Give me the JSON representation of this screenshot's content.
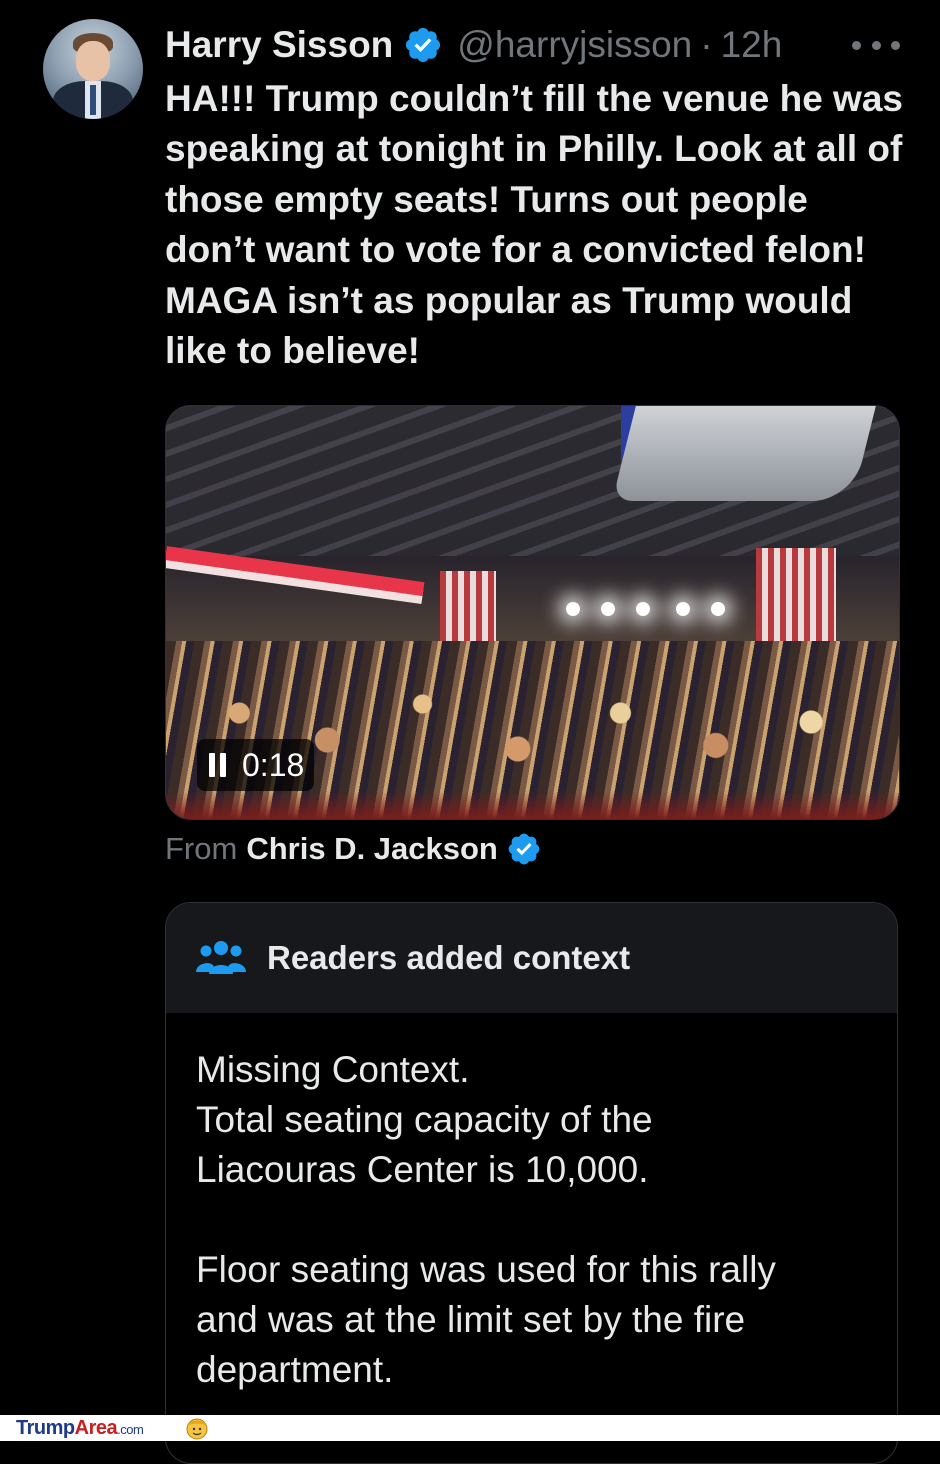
{
  "tweet": {
    "author_name": "Harry Sisson",
    "handle": "@harryjsisson",
    "separator": "·",
    "time": "12h",
    "text": "HA!!! Trump couldn’t fill the venue he was speaking at tonight in Philly. Look at all of those empty seats! Turns out people don’t want to vote for a convicted felon! MAGA isn’t as popular as Trump would like to believe!"
  },
  "media": {
    "video_time": "0:18",
    "from_label": "From",
    "from_name": "Chris D. Jackson"
  },
  "community_note": {
    "title": "Readers added context",
    "lines": [
      "Missing Context.",
      "Total seating capacity of the",
      "Liacouras Center is 10,000.",
      "Floor seating was used for this rally",
      "and was at the limit set by the fire",
      "department."
    ]
  },
  "watermark": {
    "trump": "Trump",
    "area": "Area",
    "com": ".com"
  },
  "colors": {
    "background": "#000000",
    "text": "#e7e9ea",
    "secondary": "#71767b",
    "verified": "#1d9bf0",
    "note_header": "#16181c"
  },
  "icons": [
    "verified-badge-icon",
    "more-icon",
    "pause-icon",
    "people-icon",
    "watermark-logo-icon"
  ]
}
